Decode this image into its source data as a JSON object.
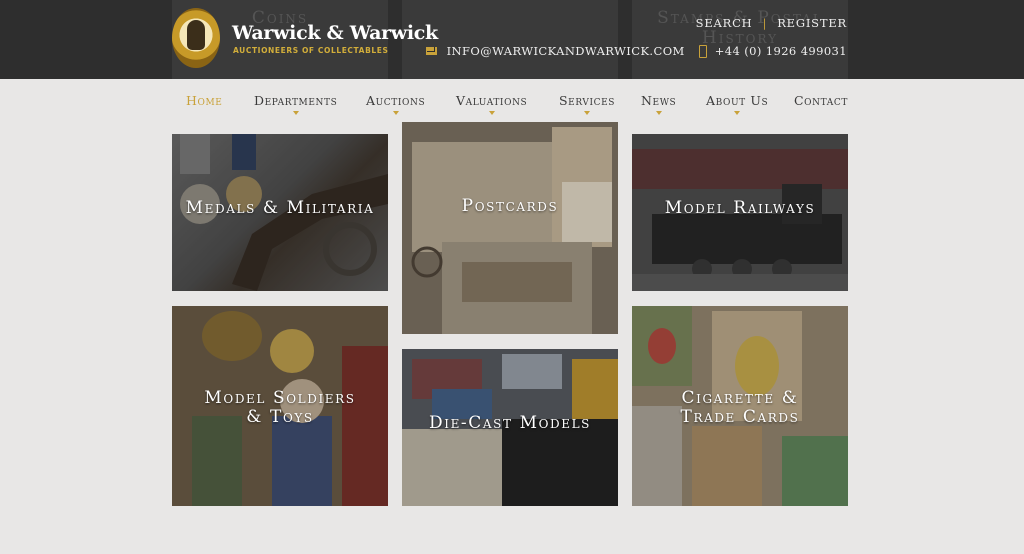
{
  "header": {
    "logo_name": "Warwick & Warwick",
    "logo_tagline": "AUCTIONEERS OF COLLECTABLES",
    "links": {
      "search": "SEARCH",
      "separator": "|",
      "register": "REGISTER"
    },
    "email": "INFO@WARWICKANDWARWICK.COM",
    "phone": "+44 (0) 1926 499031",
    "ghost_tiles": [
      "Coins",
      "Stamps & Postal History"
    ]
  },
  "nav": [
    {
      "label": "Home",
      "active": true
    },
    {
      "label": "Departments"
    },
    {
      "label": "Auctions"
    },
    {
      "label": "Valuations"
    },
    {
      "label": "Services"
    },
    {
      "label": "News"
    },
    {
      "label": "About Us"
    },
    {
      "label": "Contact"
    }
  ],
  "tiles": [
    {
      "title": "Medals & Militaria"
    },
    {
      "title": "Postcards"
    },
    {
      "title": "Model Railways"
    },
    {
      "title_line1": "Model Soldiers",
      "title_line2": "& Toys"
    },
    {
      "title": "Die-Cast Models"
    },
    {
      "title_line1": "Cigarette &",
      "title_line2": "Trade Cards"
    }
  ]
}
